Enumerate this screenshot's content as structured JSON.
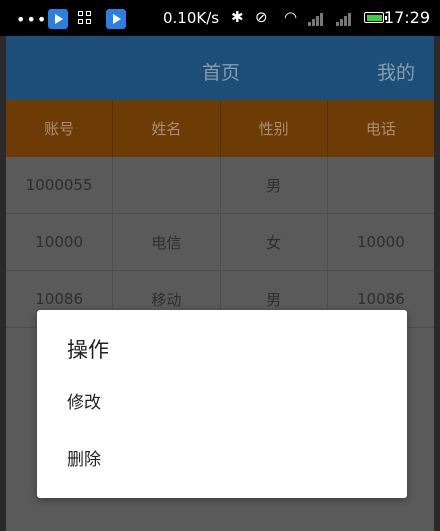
{
  "status_bar": {
    "dots": "•••",
    "speed": "0.10K/s",
    "time": "17:29",
    "icons": [
      "play-app-icon",
      "grid-app-icon",
      "play-app-icon",
      "bluetooth-icon",
      "vibrate-mute-icon",
      "wifi-icon",
      "signal-icon",
      "signal-icon",
      "battery-icon"
    ]
  },
  "nav": {
    "tab_home": "首页",
    "tab_mine": "我的"
  },
  "table": {
    "headers": [
      "账号",
      "姓名",
      "性别",
      "电话"
    ],
    "rows": [
      [
        "1000055",
        "",
        "男",
        ""
      ],
      [
        "10000",
        "电信",
        "女",
        "10000"
      ],
      [
        "10086",
        "移动",
        "男",
        "10086"
      ]
    ]
  },
  "dialog": {
    "title": "操作",
    "items": [
      "修改",
      "删除"
    ]
  },
  "colors": {
    "nav_bg": "#1c4e78",
    "header_bg": "#6d3c06",
    "overlay": "#5a5a5a"
  }
}
